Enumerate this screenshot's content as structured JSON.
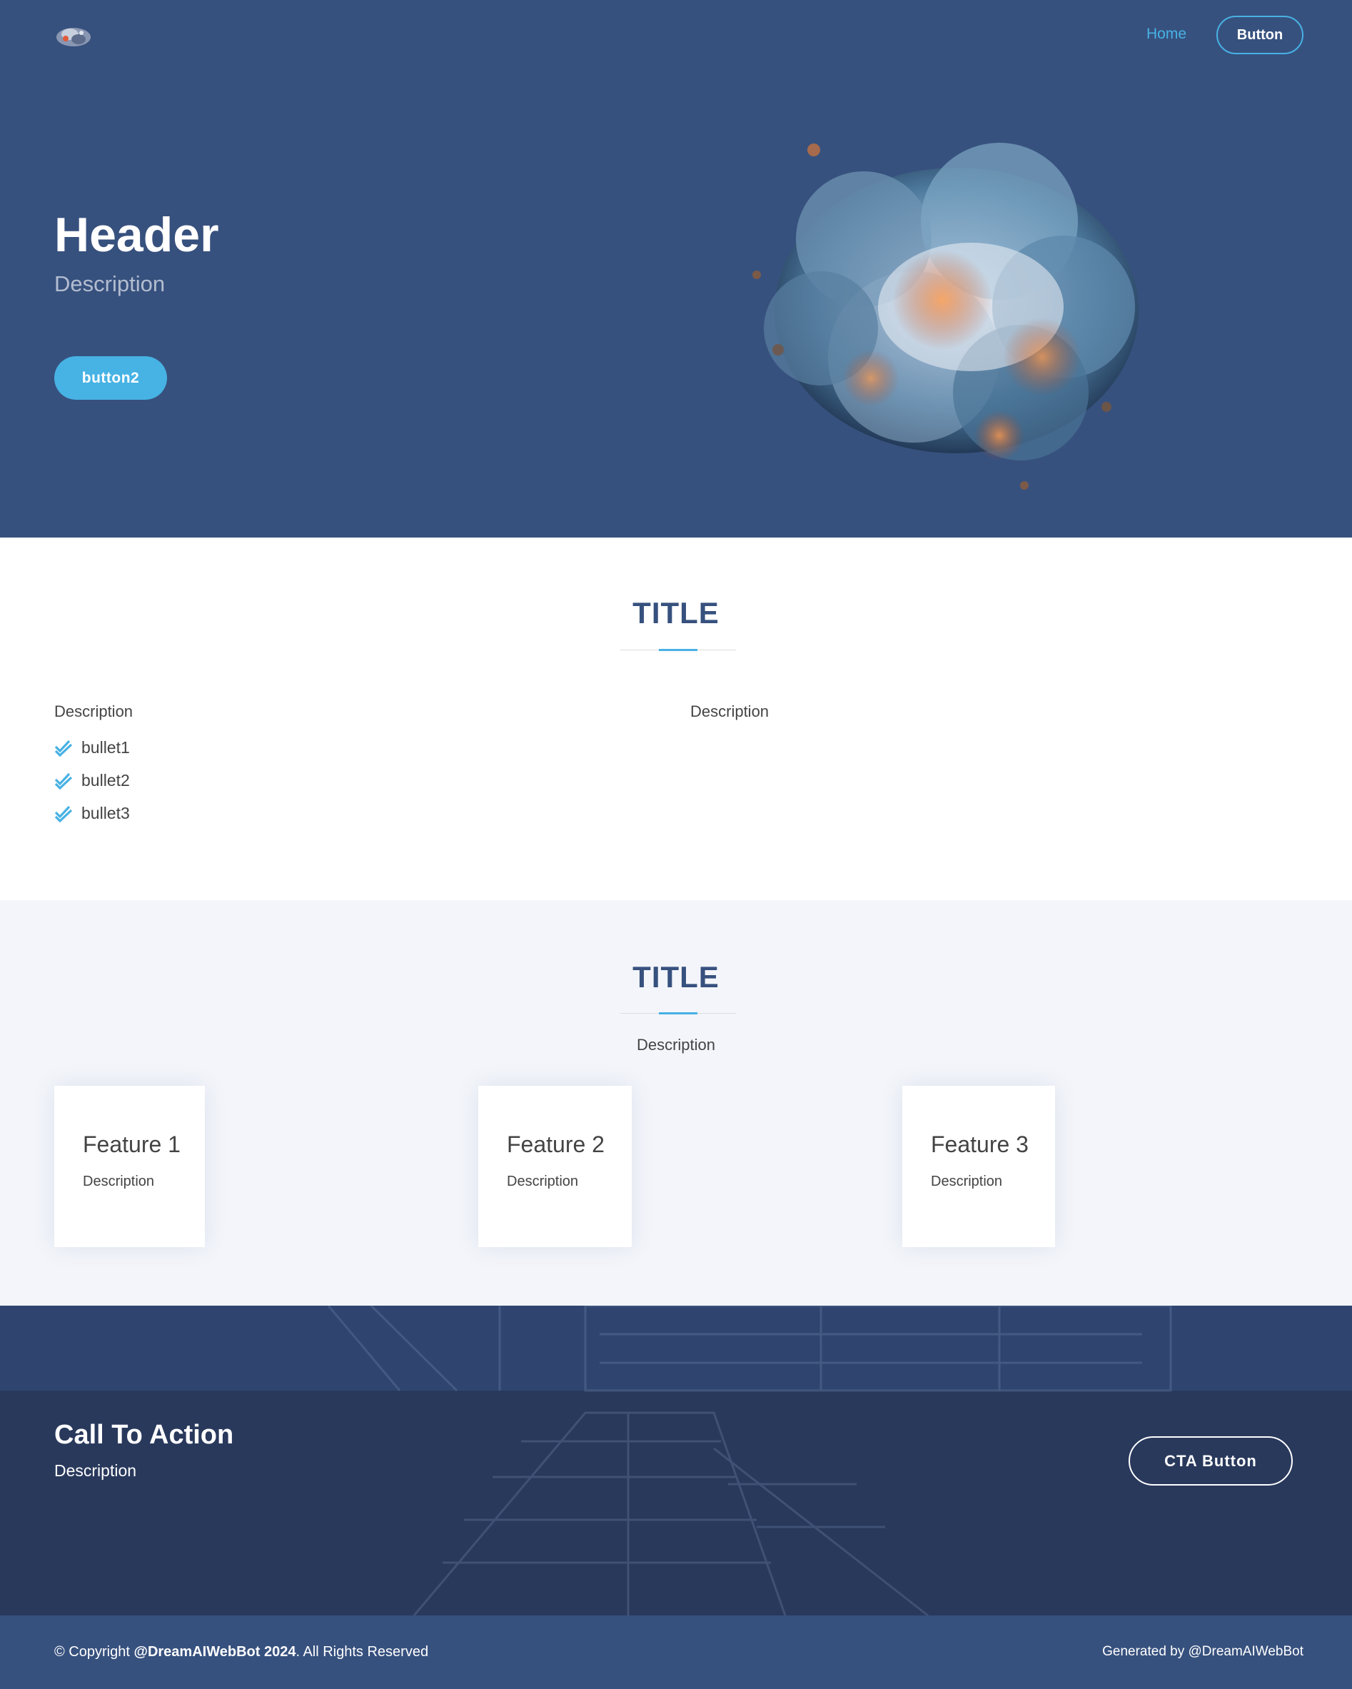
{
  "nav": {
    "home_label": "Home",
    "button_label": "Button"
  },
  "hero": {
    "title": "Header",
    "description": "Description",
    "button_label": "button2"
  },
  "about": {
    "title": "TITLE",
    "left_description": "Description",
    "right_description": "Description",
    "bullets": [
      "bullet1",
      "bullet2",
      "bullet3"
    ]
  },
  "features": {
    "title": "TITLE",
    "description": "Description",
    "cards": [
      {
        "title": "Feature 1",
        "description": "Description"
      },
      {
        "title": "Feature 2",
        "description": "Description"
      },
      {
        "title": "Feature 3",
        "description": "Description"
      }
    ]
  },
  "cta": {
    "title": "Call To Action",
    "description": "Description",
    "button_label": "CTA Button"
  },
  "footer": {
    "copyright_prefix": "© Copyright ",
    "copyright_brand": "@DreamAIWebBot 2024",
    "copyright_suffix": ". All Rights Reserved",
    "generated_by": "Generated by @DreamAIWebBot"
  },
  "colors": {
    "primary": "#37517e",
    "accent": "#47b2e4",
    "section_bg": "#f3f5fa",
    "cta_bg": "#2a3e62"
  },
  "icons": {
    "logo": "logo-icon",
    "bullet": "double-check-icon",
    "hero_art": "ai-brain-illustration"
  }
}
